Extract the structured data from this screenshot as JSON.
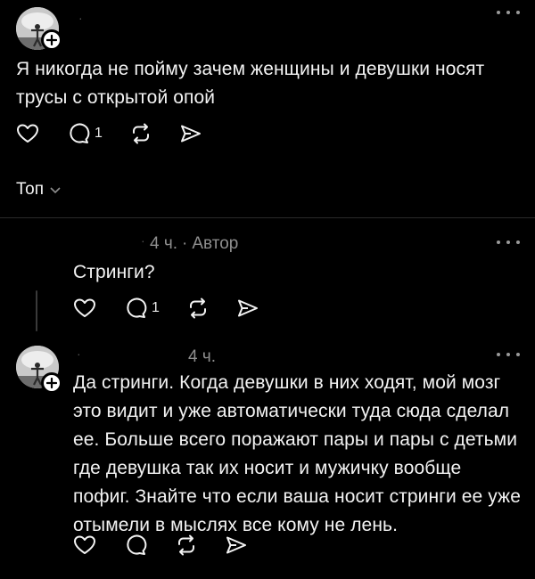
{
  "post": {
    "username": "·",
    "text_line1": "Я никогда не пойму зачем женщины и девушки носят",
    "text_line2": "трусы с открытой опой",
    "reply_count": "1"
  },
  "sort": {
    "label": "Топ"
  },
  "reply1": {
    "username": "·",
    "time": "4 ч.",
    "separator": "·",
    "author_tag": "Автор",
    "text": "Стринги?",
    "reply_count": "1"
  },
  "reply2": {
    "username": "·",
    "time": "4 ч.",
    "lines": [
      "Да стринги. Когда девушки в них ходят, мой мозг",
      "это видит и уже автоматически туда сюда сделал",
      "ее. Больше всего поражают пары и пары с детьми",
      "где девушка так их носит и мужичку вообще",
      "пофиг. Знайте что если ваша носит стринги ее уже",
      "отымели в мыслях все кому не лень."
    ]
  },
  "icons": [
    "heart-icon",
    "comment-icon",
    "repost-icon",
    "share-icon",
    "more-icon",
    "plus-icon",
    "chevron-down-icon"
  ]
}
